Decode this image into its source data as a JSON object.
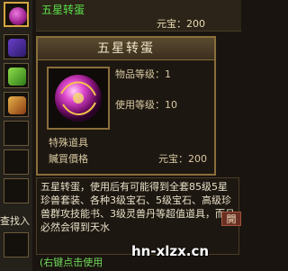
{
  "item_list": {
    "name": "五星转蛋",
    "price": "元宝：200"
  },
  "card": {
    "title": "五星转蛋",
    "item_level": "物品等级：1",
    "use_level": "使用等级：10",
    "category": "特殊道具",
    "sell_label": "贓買價格",
    "price": "元宝：200"
  },
  "description": "五星转蛋，使用后有可能得到全套85级5星珍兽套装、各种3级宝石、5级宝石、高级珍兽群攻技能书、3级灵兽丹等超值道具，而且必然会得到天水",
  "hint": "(右键点击使用",
  "side": {
    "label": "查找入",
    "right_tab": "開"
  },
  "watermark": "hn-xlzx.cn",
  "colors": {
    "item_name": "#59e04a",
    "border_gold": "#8a6e3a",
    "selected_slot": "#d4a640"
  }
}
